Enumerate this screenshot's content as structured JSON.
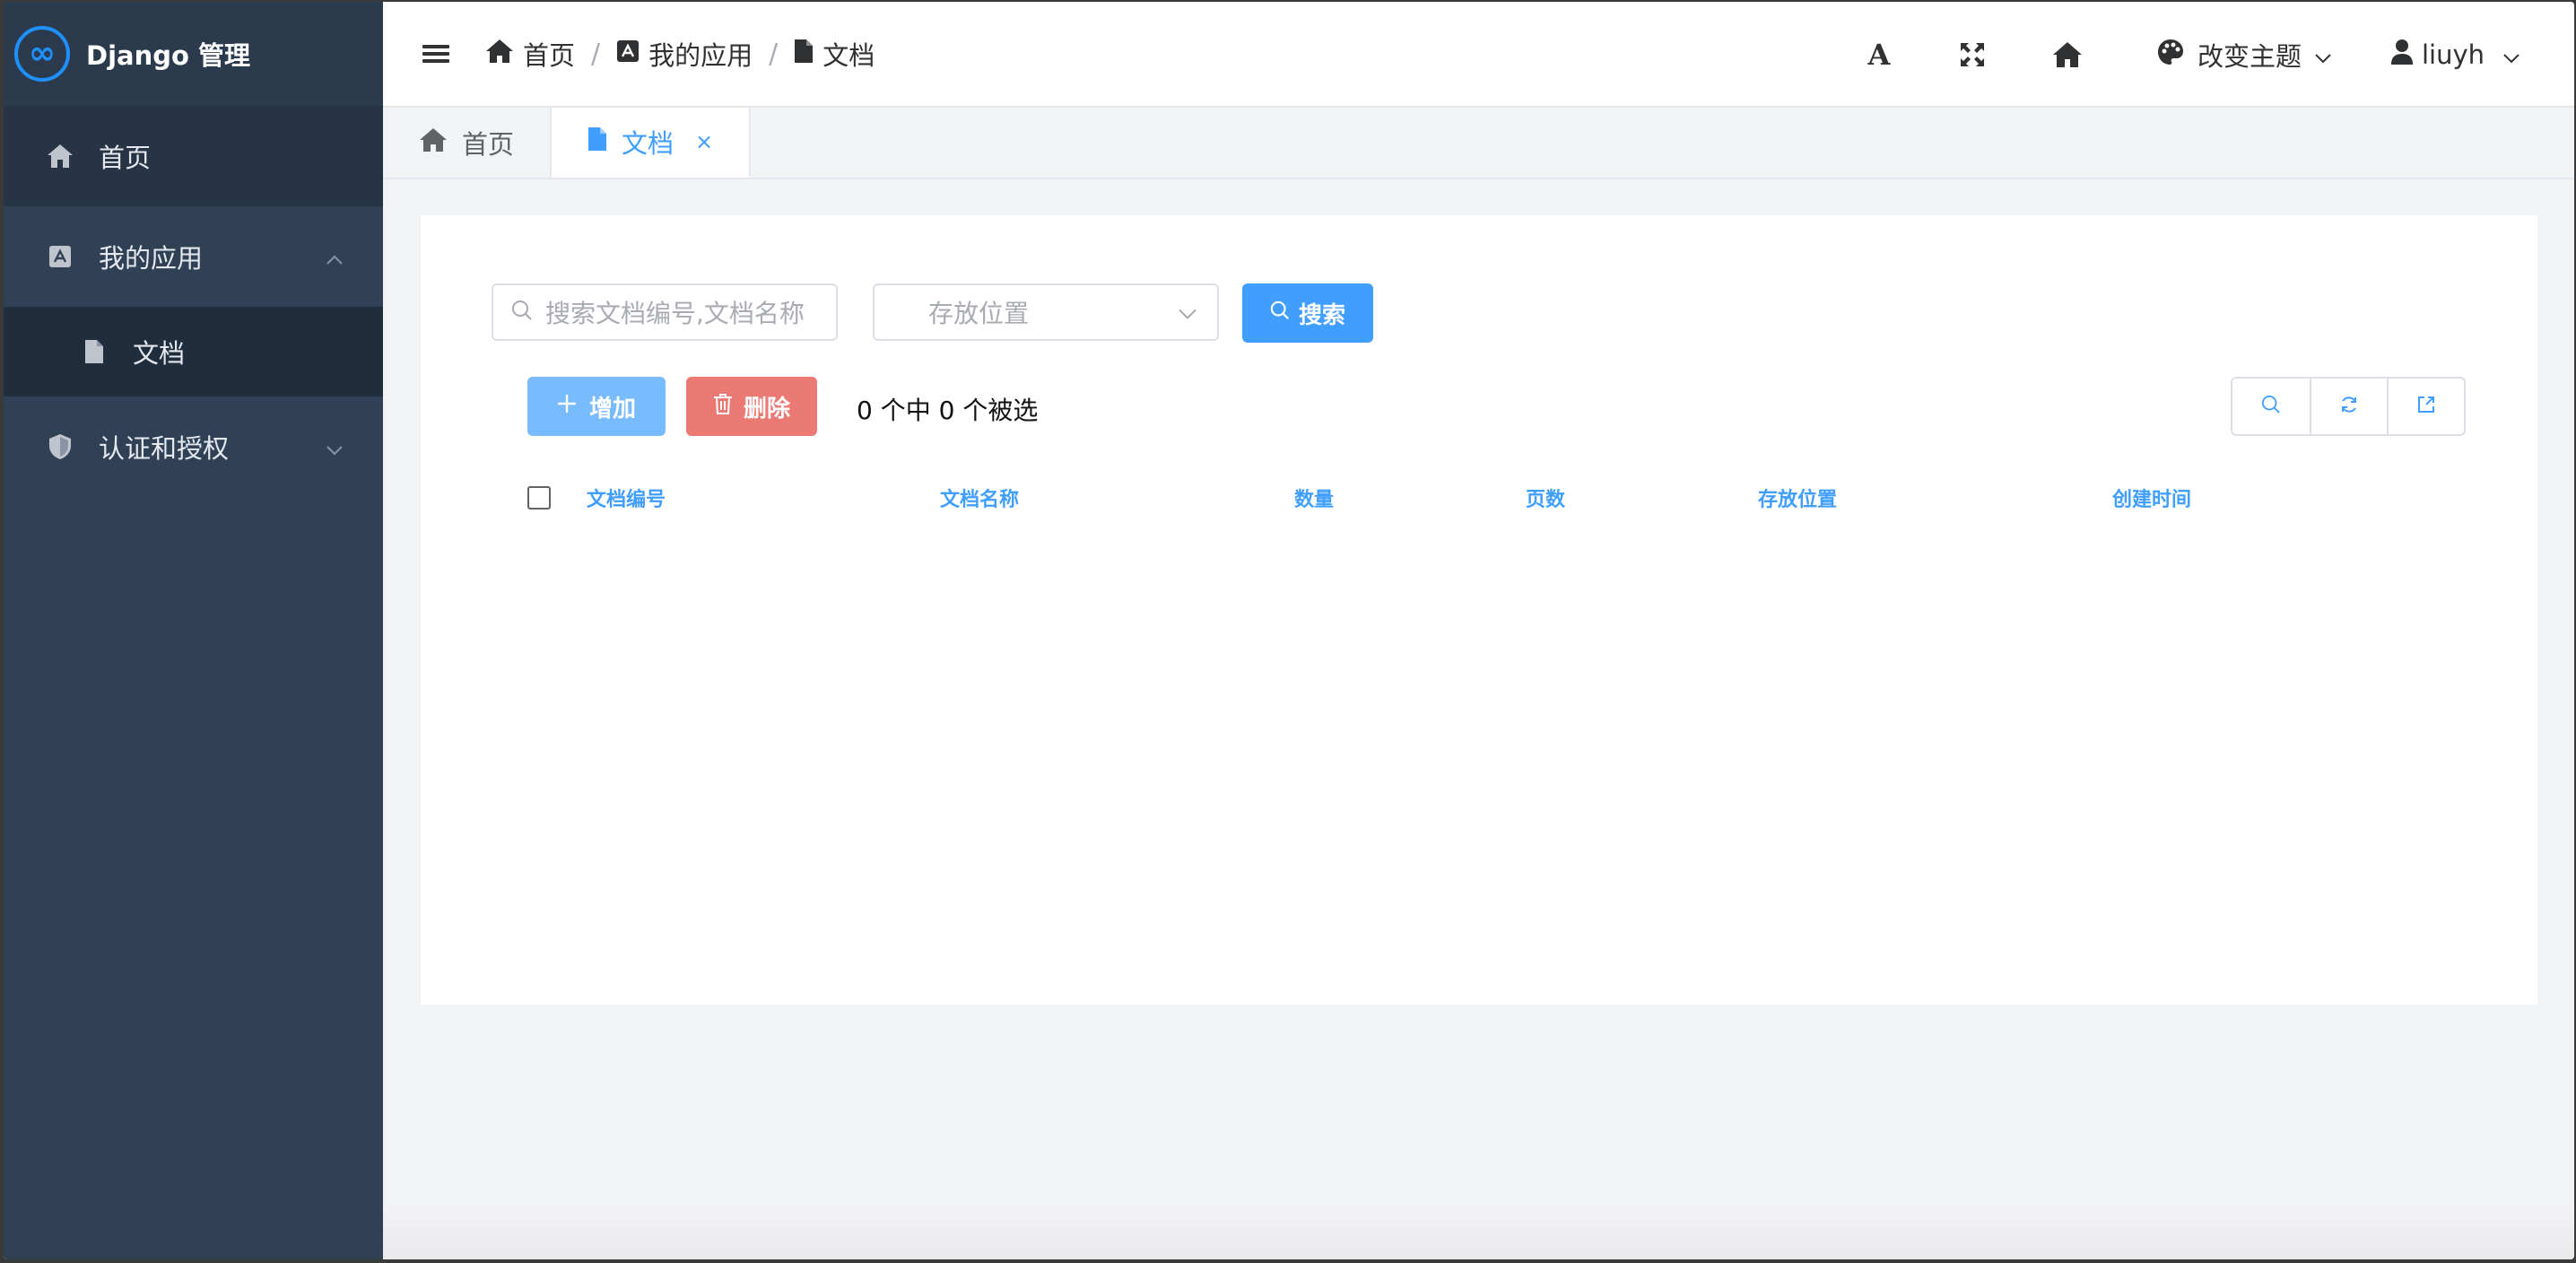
{
  "app": {
    "title": "Django 管理",
    "logo_glyph": "∞"
  },
  "sidebar": {
    "items": [
      {
        "label": "首页",
        "icon": "home-icon"
      },
      {
        "label": "我的应用",
        "icon": "app-icon",
        "expanded": true,
        "children": [
          {
            "label": "文档",
            "icon": "file-icon"
          }
        ]
      },
      {
        "label": "认证和授权",
        "icon": "shield-icon",
        "expanded": false
      }
    ]
  },
  "navbar": {
    "breadcrumb": [
      {
        "label": "首页",
        "icon": "home-icon"
      },
      {
        "label": "我的应用",
        "icon": "app-icon"
      },
      {
        "label": "文档",
        "icon": "file-icon"
      }
    ],
    "separator": "/",
    "font_size_glyph": "A",
    "theme_label": "改变主题",
    "user_name": "liuyh"
  },
  "tags": [
    {
      "label": "首页",
      "icon": "home-icon",
      "active": false
    },
    {
      "label": "文档",
      "icon": "file-icon",
      "active": true,
      "close": "×"
    }
  ],
  "toolbar": {
    "search_placeholder": "搜索文档编号,文档名称",
    "location_placeholder": "存放位置",
    "search_label": "搜索",
    "add_label": "增加",
    "delete_label": "删除",
    "selection_text": "0 个中 0 个被选"
  },
  "table": {
    "columns": [
      "文档编号",
      "文档名称",
      "数量",
      "页数",
      "存放位置",
      "创建时间"
    ],
    "rows": []
  },
  "colors": {
    "sidebar_bg": "#304156",
    "primary": "#409eff",
    "add_button": "#79bbff",
    "delete_button": "#eb7a74"
  }
}
